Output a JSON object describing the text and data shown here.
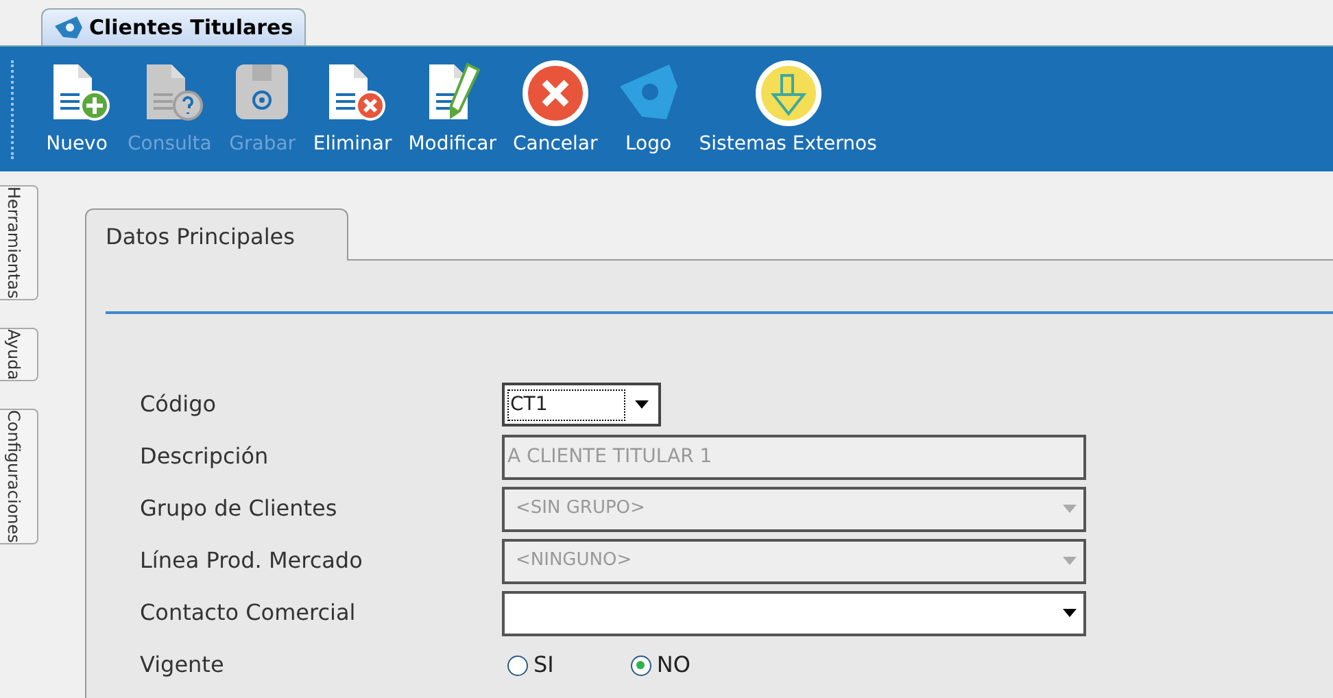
{
  "window": {
    "title": "Clientes Titulares"
  },
  "toolbar": [
    {
      "kind": "new",
      "label": "Nuevo",
      "disabled": false
    },
    {
      "kind": "query",
      "label": "Consulta",
      "disabled": true
    },
    {
      "kind": "save",
      "label": "Grabar",
      "disabled": true
    },
    {
      "kind": "delete",
      "label": "Eliminar",
      "disabled": false
    },
    {
      "kind": "edit",
      "label": "Modificar",
      "disabled": false
    },
    {
      "kind": "cancel",
      "label": "Cancelar",
      "disabled": false
    },
    {
      "kind": "logo",
      "label": "Logo",
      "disabled": false
    },
    {
      "kind": "external",
      "label": "Sistemas Externos",
      "disabled": false
    }
  ],
  "side_tabs": [
    {
      "label": "Herramientas"
    },
    {
      "label": "Ayuda"
    },
    {
      "label": "Configuraciones"
    }
  ],
  "tabs": [
    {
      "label": "Datos Principales",
      "selected": true
    }
  ],
  "form": [
    {
      "label": "Código",
      "kind": "combo",
      "value": "CT1",
      "disabled": false
    },
    {
      "label": "Descripción",
      "kind": "text",
      "value": "A CLIENTE TITULAR 1",
      "disabled": true
    },
    {
      "label": "Grupo de Clientes",
      "kind": "select",
      "value": "<SIN GRUPO>",
      "disabled": true
    },
    {
      "label": "Línea Prod. Mercado",
      "kind": "select",
      "value": "<NINGUNO>",
      "disabled": true
    },
    {
      "label": "Contacto Comercial",
      "kind": "select",
      "disabled": false
    },
    {
      "label": "Vigente",
      "kind": "radio",
      "options": [
        {
          "label": "SI",
          "selected": false
        },
        {
          "label": "NO",
          "selected": true
        }
      ]
    }
  ]
}
